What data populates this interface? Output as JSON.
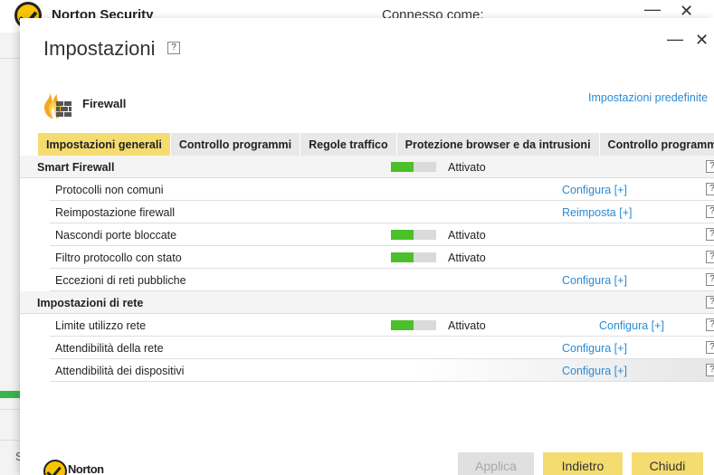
{
  "background_window": {
    "app_name": "Norton Security",
    "connected_label": "Connesso come:",
    "minimize_glyph": "—",
    "close_glyph": "✕",
    "side_letter": "S"
  },
  "dialog": {
    "title": "Impostazioni",
    "help_glyph": "?",
    "minimize_glyph": "—",
    "close_glyph": "✕",
    "section_title": "Firewall",
    "default_settings_link": "Impostazioni predefinite"
  },
  "tabs": [
    {
      "label": "Impostazioni generali",
      "active": true
    },
    {
      "label": "Controllo programmi",
      "active": false
    },
    {
      "label": "Regole traffico",
      "active": false
    },
    {
      "label": "Protezione browser e da intrusioni",
      "active": false
    },
    {
      "label": "Controllo programmi avanzato",
      "active": false
    }
  ],
  "rows": [
    {
      "label": "Smart Firewall",
      "status": "Attivato",
      "toggle_level": 0.5,
      "action": "",
      "help": "?"
    },
    {
      "label": "Protocolli non comuni",
      "status": "",
      "action": "Configura [+]",
      "help": "?"
    },
    {
      "label": "Reimpostazione firewall",
      "status": "",
      "action": "Reimposta [+]",
      "help": "?"
    },
    {
      "label": "Nascondi porte bloccate",
      "status": "Attivato",
      "toggle_level": 0.5,
      "action": "",
      "help": "?"
    },
    {
      "label": "Filtro protocollo con stato",
      "status": "Attivato",
      "toggle_level": 0.5,
      "action": "",
      "help": "?"
    },
    {
      "label": "Eccezioni di reti pubbliche",
      "status": "",
      "action": "Configura [+]",
      "help": "?"
    },
    {
      "label": "Impostazioni di rete",
      "status": "",
      "action": "",
      "help": "?"
    },
    {
      "label": "Limite utilizzo rete",
      "status": "Attivato",
      "toggle_level": 0.5,
      "action": "Configura [+]",
      "help": "?"
    },
    {
      "label": "Attendibilità della rete",
      "status": "",
      "action": "Configura [+]",
      "help": "?"
    },
    {
      "label": "Attendibilità dei dispositivi",
      "status": "",
      "action": "Configura [+]",
      "help": "?"
    }
  ],
  "footer": {
    "brand": "Norton",
    "apply_label": "Applica",
    "back_label": "Indietro",
    "close_label": "Chiudi"
  },
  "colors": {
    "accent_yellow": "#f5dc70",
    "link_blue": "#2a8ad4",
    "toggle_green": "#4cc02a"
  }
}
